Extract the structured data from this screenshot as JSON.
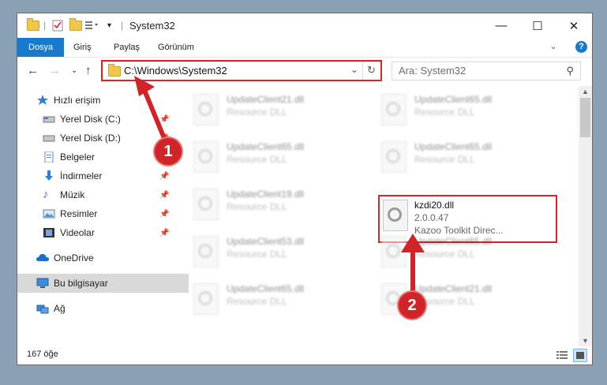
{
  "window": {
    "title": "System32"
  },
  "ribbon": {
    "tabs": [
      "Dosya",
      "Giriş",
      "Paylaş",
      "Görünüm"
    ],
    "help": "?"
  },
  "address": {
    "path": "C:\\Windows\\System32"
  },
  "search": {
    "placeholder": "Ara: System32"
  },
  "sidebar": {
    "items": [
      {
        "label": "Hızlı erişim"
      },
      {
        "label": "Yerel Disk (C:)"
      },
      {
        "label": "Yerel Disk (D:)"
      },
      {
        "label": "Belgeler"
      },
      {
        "label": "İndirmeler"
      },
      {
        "label": "Müzik"
      },
      {
        "label": "Resimler"
      },
      {
        "label": "Videolar"
      },
      {
        "label": "OneDrive"
      },
      {
        "label": "Bu bilgisayar"
      },
      {
        "label": "Ağ"
      }
    ]
  },
  "files": {
    "left": [
      {
        "name": "UpdateClient21.dll",
        "type": "Resource DLL"
      },
      {
        "name": "UpdateClient65.dll",
        "type": "Resource DLL"
      },
      {
        "name": "UpdateClient19.dll",
        "type": "Resource DLL"
      },
      {
        "name": "UpdateClient53.dll",
        "type": "Resource DLL"
      },
      {
        "name": "UpdateClient65.dll",
        "type": "Resource DLL"
      }
    ],
    "right": [
      {
        "name": "UpdateClient65.dll",
        "type": "Resource DLL"
      },
      {
        "name": "UpdateClient65.dll",
        "type": "Resource DLL"
      },
      {
        "name": "UpdateClient65.dll",
        "type": "Resource DLL"
      },
      {
        "name": "UpdateClient21.dll",
        "type": "Resource DLL"
      }
    ],
    "highlighted": {
      "name": "kzdi20.dll",
      "version": "2.0.0.47",
      "description": "Kazoo Toolkit Direc..."
    }
  },
  "status": {
    "count": "167 öğe"
  },
  "callouts": {
    "one": "1",
    "two": "2"
  },
  "colors": {
    "accent": "#1979ca",
    "highlight": "#d3262d"
  }
}
